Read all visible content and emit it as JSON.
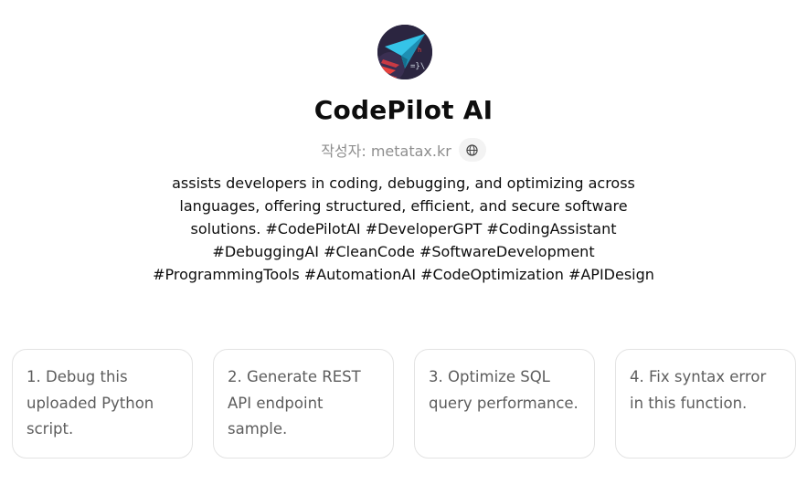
{
  "gpt": {
    "name": "CodePilot AI",
    "author_label": "작성자: metatax.kr",
    "description": "assists developers in coding, debugging, and optimizing across languages, offering structured, efficient, and secure software solutions. #CodePilotAI #DeveloperGPT #CodingAssistant #DebuggingAI #CleanCode #SoftwareDevelopment #ProgrammingTools #AutomationAI #CodeOptimization #APIDesign"
  },
  "icons": {
    "avatar": "paper-plane-logo-icon",
    "website": "globe-icon"
  },
  "conversation_starters": [
    {
      "text": "1. Debug this uploaded Python script."
    },
    {
      "text": "2. Generate REST API endpoint sample."
    },
    {
      "text": "3. Optimize SQL query performance."
    },
    {
      "text": "4. Fix syntax error in this function."
    }
  ],
  "colors": {
    "text_primary": "#0d0d0d",
    "text_secondary": "#8e8e8e",
    "starter_text": "#5d5d5d",
    "starter_border": "#e3e3e3",
    "avatar_bg": "#2b2540",
    "avatar_accent_cyan": "#35c4e8",
    "avatar_accent_red": "#e8413c"
  }
}
